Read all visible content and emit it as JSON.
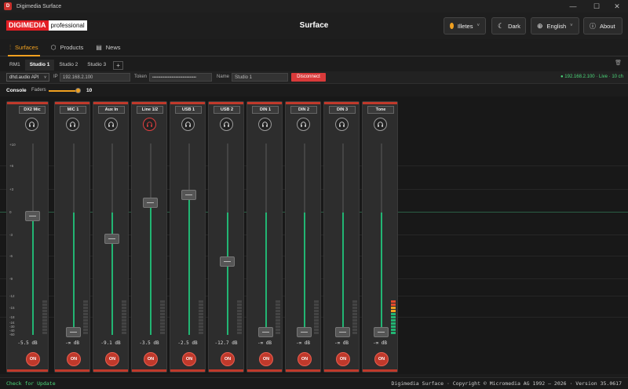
{
  "window": {
    "title": "Digimedia Surface",
    "minimize": "—",
    "maximize": "☐",
    "close": "✕"
  },
  "header": {
    "logo_a": "DIGIMEDIA",
    "logo_b": "professional",
    "title": "Surface",
    "status_label": "Illetes",
    "theme_label": "Dark",
    "lang_label": "English",
    "about_label": "About",
    "status_color": "#f0a020"
  },
  "nav": {
    "tabs": [
      {
        "label": "Surfaces"
      },
      {
        "label": "Products"
      },
      {
        "label": "News"
      }
    ]
  },
  "studio_tabs": [
    {
      "label": "RM1"
    },
    {
      "label": "Studio 1"
    },
    {
      "label": "Studio 2"
    },
    {
      "label": "Studio 3"
    }
  ],
  "add_tab": "+",
  "connection": {
    "api": "dhd.audio API",
    "ip_label": "IP",
    "ip": "192.168.2.100",
    "token_label": "Token",
    "token": "••••••••••••••••••••••••••••••••",
    "name_label": "Name",
    "name": "Studio 1",
    "disconnect": "Disconnect",
    "status": "● 192.168.2.100 · Live · 10 ch"
  },
  "console": {
    "label": "Console",
    "faders_label": "Faders",
    "faders": "10",
    "faders_fraction": 1.0
  },
  "scale": [
    "+10",
    "+6",
    "+3",
    "0",
    "-3",
    "-6",
    "-9",
    "-12",
    "-15",
    "-18",
    "-24",
    "-30",
    "-40",
    "-60"
  ],
  "channels": [
    {
      "name": "DX2 Mic",
      "db": "-5.5 dB",
      "level": 0.62,
      "monitor": false,
      "meter": 0
    },
    {
      "name": "MIC 1",
      "db": "-∞ dB",
      "level": 0.0,
      "monitor": false,
      "meter": 0
    },
    {
      "name": "Aux In",
      "db": "-9.1 dB",
      "level": 0.5,
      "monitor": false,
      "meter": 0
    },
    {
      "name": "Line 1/2",
      "db": "-3.5 dB",
      "level": 0.69,
      "monitor": true,
      "meter": 0
    },
    {
      "name": "USB 1",
      "db": "-2.5 dB",
      "level": 0.73,
      "monitor": false,
      "meter": 0
    },
    {
      "name": "USB 2",
      "db": "-12.7 dB",
      "level": 0.38,
      "monitor": false,
      "meter": 0
    },
    {
      "name": "DIN 1",
      "db": "-∞ dB",
      "level": 0.0,
      "monitor": false,
      "meter": 0
    },
    {
      "name": "DIN 2",
      "db": "-∞ dB",
      "level": 0.0,
      "monitor": false,
      "meter": 0
    },
    {
      "name": "DIN 3",
      "db": "-∞ dB",
      "level": 0.0,
      "monitor": false,
      "meter": 0
    },
    {
      "name": "Tone",
      "db": "-∞ dB",
      "level": 0.0,
      "monitor": false,
      "meter": 1.0
    }
  ],
  "on_label": "ON",
  "footer": {
    "update": "Check for Update",
    "copyright": "Digimedia Surface · Copyright © Micromedia AG 1992 – 2026 · Version 35.0617"
  },
  "colors": {
    "accent": "#f0a020",
    "fader_green": "#22b573",
    "on_red": "#c0392b",
    "live_green": "#4cd97b"
  }
}
